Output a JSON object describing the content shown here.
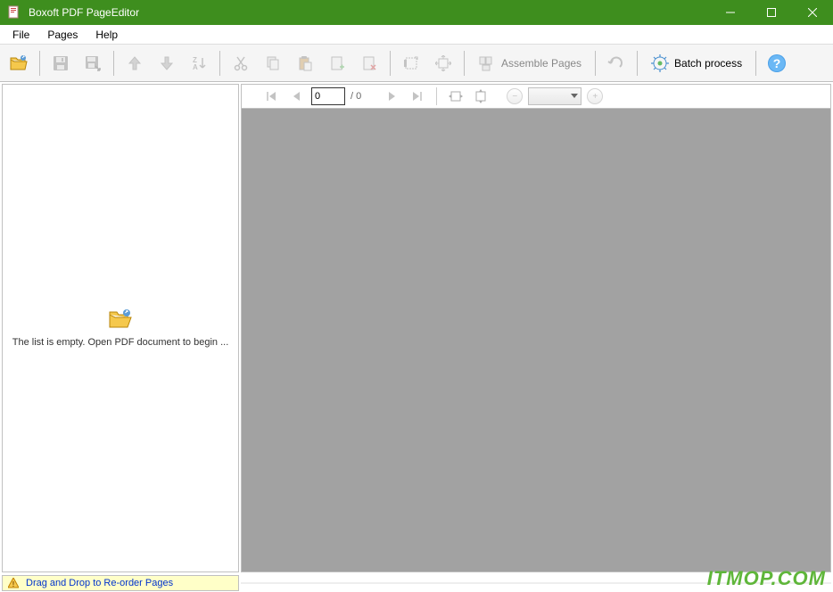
{
  "window": {
    "title": "Boxoft PDF PageEditor"
  },
  "menu": {
    "file": "File",
    "pages": "Pages",
    "help": "Help"
  },
  "toolbar": {
    "assemble": "Assemble Pages",
    "batch": "Batch process"
  },
  "sidebar": {
    "empty_text": "The list is empty. Open  PDF document to begin ..."
  },
  "nav": {
    "page_value": "0",
    "page_total": "/ 0"
  },
  "status": {
    "hint": "Drag and Drop to Re-order Pages"
  },
  "watermark": "ITMOP.COM"
}
